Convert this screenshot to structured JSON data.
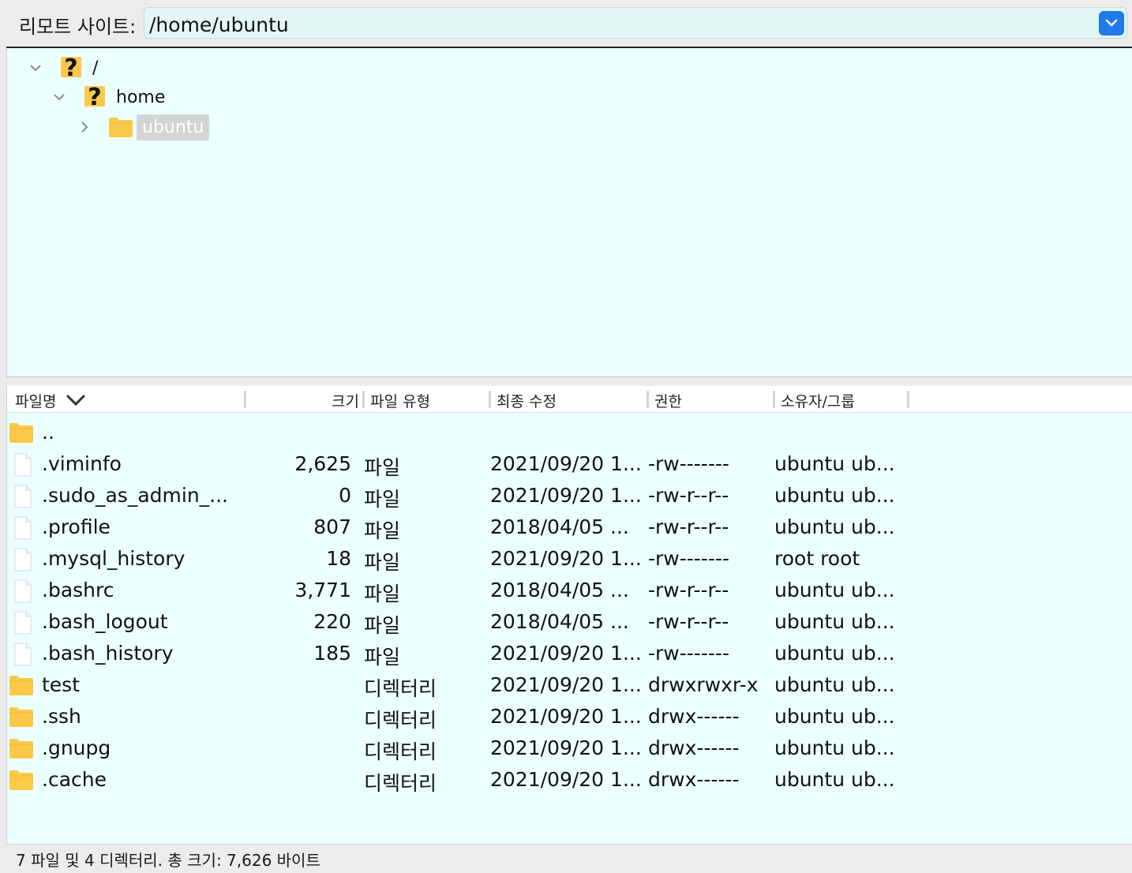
{
  "topbar": {
    "label": "리모트 사이트:",
    "path": "/home/ubuntu"
  },
  "tree": [
    {
      "label": "/",
      "icon": "unknown-question-icon",
      "expanded": true
    },
    {
      "label": "home",
      "icon": "unknown-question-icon",
      "expanded": true
    },
    {
      "label": "ubuntu",
      "icon": "folder-icon",
      "expanded": false,
      "selected": true
    }
  ],
  "columns": {
    "name": "파일명",
    "size": "크기",
    "type": "파일 유형",
    "modified": "최종 수정",
    "perms": "권한",
    "owner": "소유자/그룹"
  },
  "rows": [
    {
      "icon": "folder",
      "name": "..",
      "size": "",
      "type": "",
      "modified": "",
      "perms": "",
      "owner": ""
    },
    {
      "icon": "file",
      "name": ".viminfo",
      "size": "2,625",
      "type": "파일",
      "modified": "2021/09/20 1...",
      "perms": "-rw-------",
      "owner": "ubuntu ub..."
    },
    {
      "icon": "file",
      "name": ".sudo_as_admin_...",
      "size": "0",
      "type": "파일",
      "modified": "2021/09/20 1...",
      "perms": "-rw-r--r--",
      "owner": "ubuntu ub..."
    },
    {
      "icon": "file",
      "name": ".profile",
      "size": "807",
      "type": "파일",
      "modified": "2018/04/05 ...",
      "perms": "-rw-r--r--",
      "owner": "ubuntu ub..."
    },
    {
      "icon": "file",
      "name": ".mysql_history",
      "size": "18",
      "type": "파일",
      "modified": "2021/09/20 1...",
      "perms": "-rw-------",
      "owner": "root root"
    },
    {
      "icon": "file",
      "name": ".bashrc",
      "size": "3,771",
      "type": "파일",
      "modified": "2018/04/05 ...",
      "perms": "-rw-r--r--",
      "owner": "ubuntu ub..."
    },
    {
      "icon": "file",
      "name": ".bash_logout",
      "size": "220",
      "type": "파일",
      "modified": "2018/04/05 ...",
      "perms": "-rw-r--r--",
      "owner": "ubuntu ub..."
    },
    {
      "icon": "file",
      "name": ".bash_history",
      "size": "185",
      "type": "파일",
      "modified": "2021/09/20 1...",
      "perms": "-rw-------",
      "owner": "ubuntu ub..."
    },
    {
      "icon": "folder",
      "name": "test",
      "size": "",
      "type": "디렉터리",
      "modified": "2021/09/20 1...",
      "perms": "drwxrwxr-x",
      "owner": "ubuntu ub..."
    },
    {
      "icon": "folder",
      "name": ".ssh",
      "size": "",
      "type": "디렉터리",
      "modified": "2021/09/20 1...",
      "perms": "drwx------",
      "owner": "ubuntu ub..."
    },
    {
      "icon": "folder",
      "name": ".gnupg",
      "size": "",
      "type": "디렉터리",
      "modified": "2021/09/20 1...",
      "perms": "drwx------",
      "owner": "ubuntu ub..."
    },
    {
      "icon": "folder",
      "name": ".cache",
      "size": "",
      "type": "디렉터리",
      "modified": "2021/09/20 1...",
      "perms": "drwx------",
      "owner": "ubuntu ub..."
    }
  ],
  "status": "7 파일 및 4 디렉터리. 총 크기: 7,626 바이트",
  "colors": {
    "pane_bg": "#ecffff",
    "folder": "#fbc94a",
    "accent": "#1f7ae8"
  }
}
